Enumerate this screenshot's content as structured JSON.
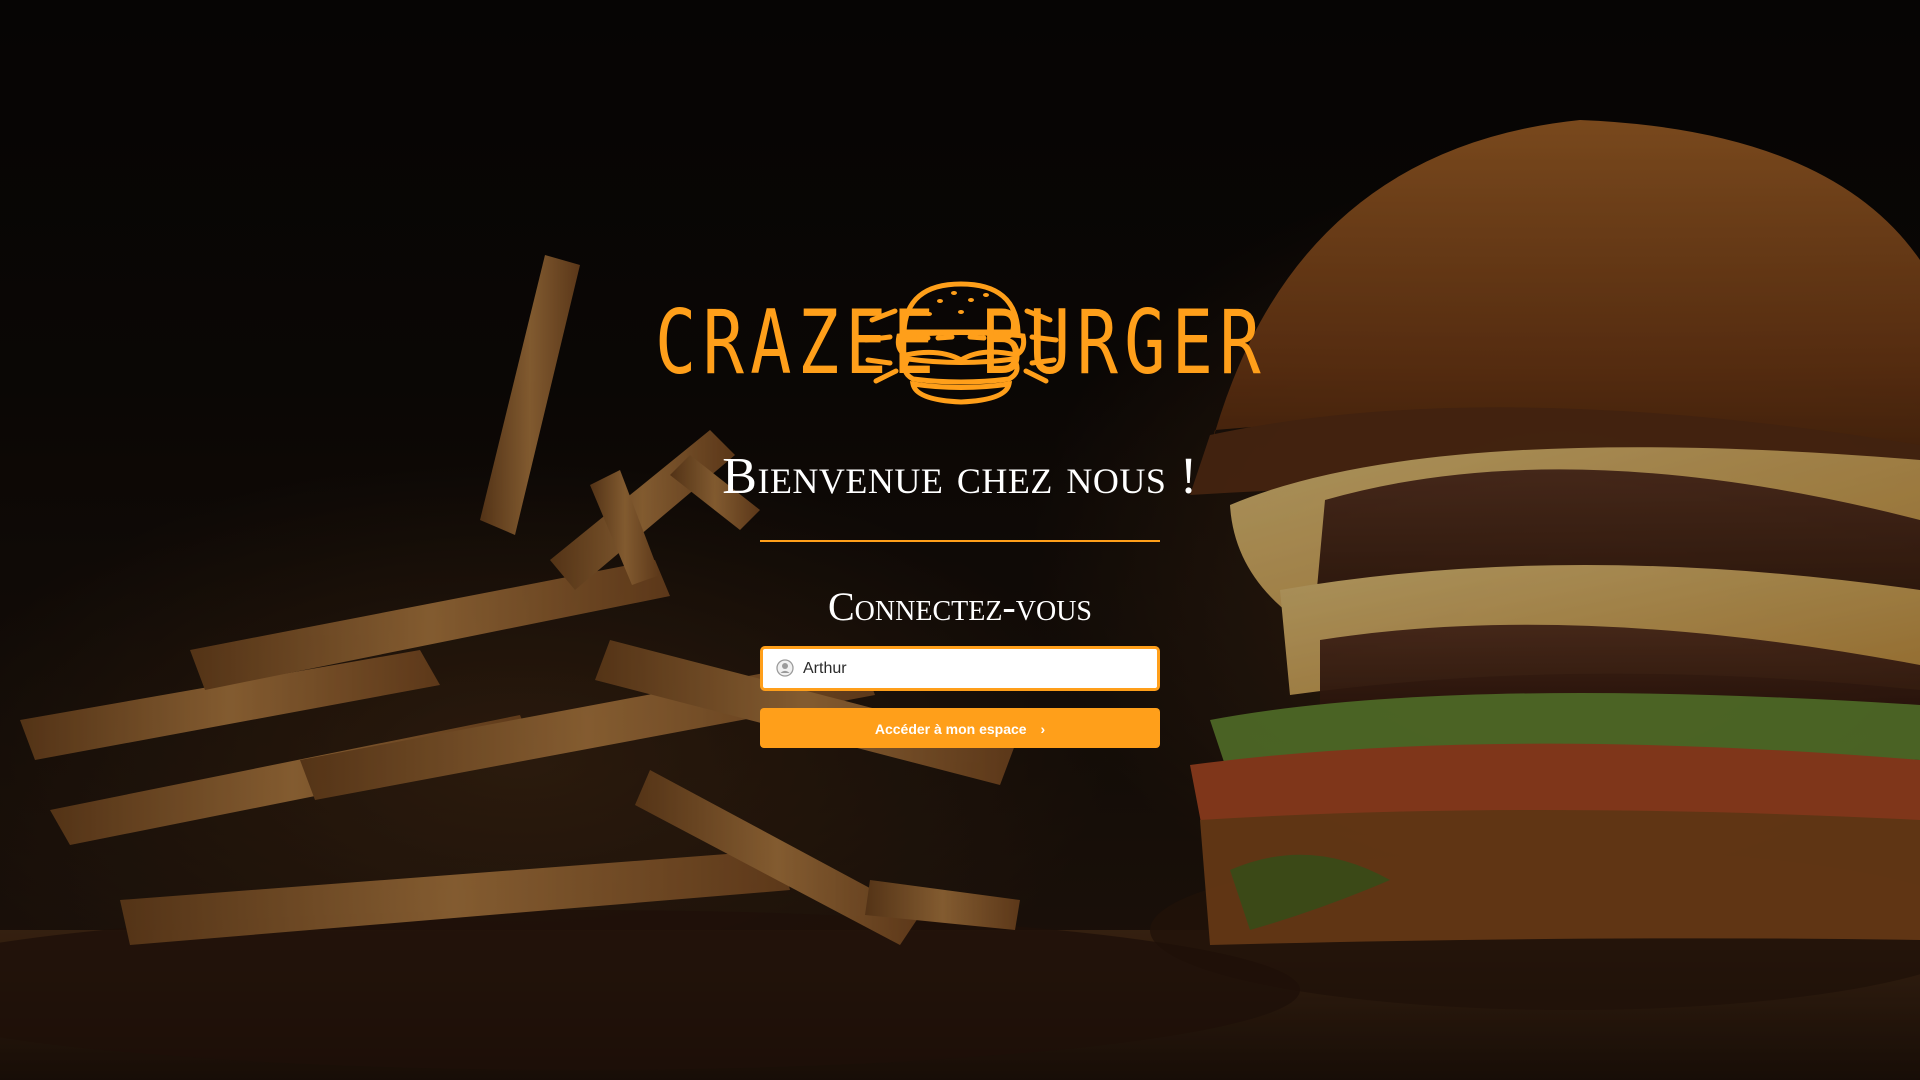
{
  "brand": {
    "left_word": "CRAZEE",
    "right_word": "BURGER",
    "accent_color": "#ff9f1a"
  },
  "headings": {
    "welcome": "Bienvenue chez nous !",
    "connect": "Connectez-vous"
  },
  "login": {
    "input_value": "Arthur",
    "input_icon": "user-icon",
    "button_label": "Accéder à mon espace",
    "button_icon": "chevron-right-icon"
  },
  "background": {
    "subject": "burger and fries photo"
  }
}
